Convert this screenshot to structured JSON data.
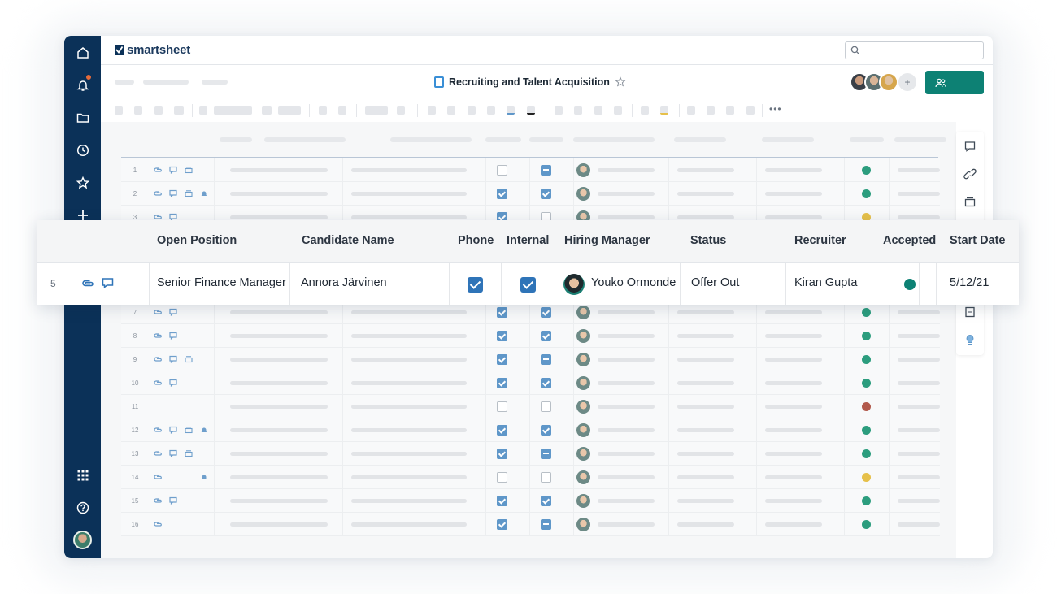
{
  "app": {
    "brand": "smartsheet",
    "sheet_title": "Recruiting and Talent Acquisition"
  },
  "nav": {
    "notification_count": "",
    "icons": [
      "home-icon",
      "bell-icon",
      "folder-icon",
      "clock-icon",
      "star-icon",
      "plus-icon",
      "apps-grid-icon",
      "help-icon"
    ]
  },
  "colors": {
    "nav_bg": "#0b3158",
    "share_button": "#0d8174",
    "check": "#2f74b8",
    "dot_green": "#2c9d7e",
    "dot_yellow": "#e6c04a",
    "dot_red": "#b25a4c"
  },
  "background_rows": [
    {
      "num": "1",
      "icons": [
        "attach",
        "comment",
        "proof"
      ],
      "phone": "off",
      "internal": "ind",
      "dot": "green"
    },
    {
      "num": "2",
      "icons": [
        "attach",
        "comment",
        "proof",
        "bell"
      ],
      "phone": "on",
      "internal": "on",
      "dot": "green"
    },
    {
      "num": "3",
      "icons": [
        "attach",
        "comment"
      ],
      "phone": "on",
      "internal": "off",
      "dot": "yellow"
    },
    {
      "num": "7",
      "icons": [
        "attach",
        "comment"
      ],
      "phone": "on",
      "internal": "on",
      "dot": "green"
    },
    {
      "num": "8",
      "icons": [
        "attach",
        "comment"
      ],
      "phone": "on",
      "internal": "on",
      "dot": "green"
    },
    {
      "num": "9",
      "icons": [
        "attach",
        "comment",
        "proof"
      ],
      "phone": "on",
      "internal": "ind",
      "dot": "green"
    },
    {
      "num": "10",
      "icons": [
        "attach",
        "comment"
      ],
      "phone": "on",
      "internal": "on",
      "dot": "green"
    },
    {
      "num": "11",
      "icons": [],
      "phone": "off",
      "internal": "off",
      "dot": "red"
    },
    {
      "num": "12",
      "icons": [
        "attach",
        "comment",
        "proof",
        "bell"
      ],
      "phone": "on",
      "internal": "on",
      "dot": "green"
    },
    {
      "num": "13",
      "icons": [
        "attach",
        "comment",
        "proof"
      ],
      "phone": "on",
      "internal": "ind",
      "dot": "green"
    },
    {
      "num": "14",
      "icons": [
        "attach",
        "",
        "",
        "bell"
      ],
      "phone": "off",
      "internal": "off",
      "dot": "yellow"
    },
    {
      "num": "15",
      "icons": [
        "attach",
        "comment"
      ],
      "phone": "on",
      "internal": "on",
      "dot": "green"
    },
    {
      "num": "16",
      "icons": [
        "attach"
      ],
      "phone": "on",
      "internal": "ind",
      "dot": "green"
    }
  ],
  "table": {
    "columns": [
      "Open Position",
      "Candidate Name",
      "Phone",
      "Internal",
      "Hiring Manager",
      "Status",
      "Recruiter",
      "Accepted",
      "Start Date"
    ],
    "highlighted_row": {
      "row_number": "5",
      "open_position": "Senior Finance Manager",
      "candidate_name": "Annora Järvinen",
      "phone": true,
      "internal": true,
      "hiring_manager": "Youko Ormonde",
      "status": "Offer Out",
      "recruiter": "Kiran Gupta",
      "accepted": "green",
      "start_date": "5/12/21"
    }
  }
}
